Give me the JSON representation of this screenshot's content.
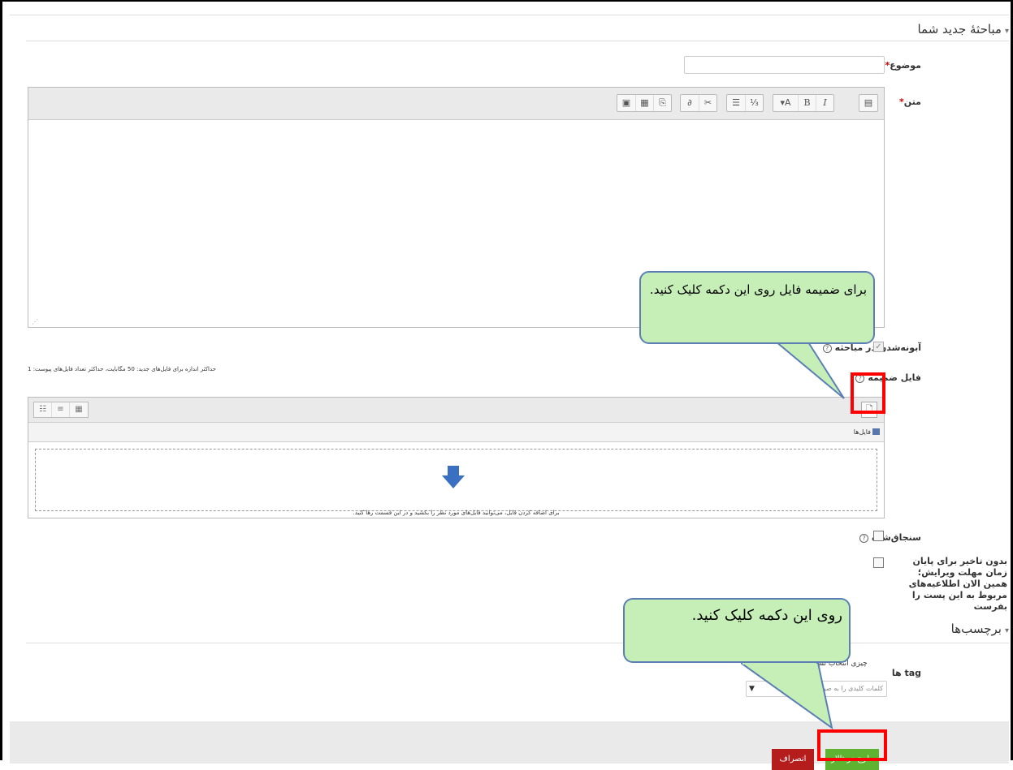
{
  "section_discussion": {
    "title": "مباحثهٔ جدید شما"
  },
  "subject": {
    "label": "موضوع",
    "value": ""
  },
  "message": {
    "label": "متن"
  },
  "editor_toolbar": [
    {
      "name": "toggle-toolbar",
      "glyph": "▤"
    },
    {
      "name": "font-style",
      "glyph": "▾A"
    },
    {
      "name": "bold",
      "glyph": "B"
    },
    {
      "name": "italic",
      "glyph": "I"
    },
    {
      "name": "unordered-list",
      "glyph": "☰"
    },
    {
      "name": "ordered-list",
      "glyph": "⅓"
    },
    {
      "name": "link",
      "glyph": "∂"
    },
    {
      "name": "unlink",
      "glyph": "✂"
    },
    {
      "name": "image",
      "glyph": "▣"
    },
    {
      "name": "media",
      "glyph": "▦"
    },
    {
      "name": "manage-files",
      "glyph": "⎘"
    }
  ],
  "subscribe": {
    "label": "آبونه‌شدن در مباحثه",
    "checked": true
  },
  "attachment": {
    "label": "فایل ضمیمه",
    "limits": "حداکثر اندازه برای فایل‌های جدید: 50 مگابایت، حداکثر تعداد فایل‌های پیوست: 1",
    "path": "فایل‌ها",
    "drop_text": "برای اضافه کردن فایل، می‌توانید فایل‌های مورد نظر را بکشید و در این قسمت رها کنید."
  },
  "pinned": {
    "label": "سنجاق‌شده",
    "checked": false
  },
  "mail_now": {
    "label": "بدون تاخیر برای پایان زمان مهلت ویرایش؛ همین الان اطلاعیه‌های مربوط به این پست را بفرست",
    "checked": false
  },
  "section_tags": {
    "title": "برچسب‌ها"
  },
  "tags": {
    "label": "tag ها",
    "no_selection": "چیزی انتخاب نشده",
    "placeholder": "کلمات کلیدی را به صورت تگ وارد کنید"
  },
  "buttons": {
    "submit": "طرح در تالار",
    "cancel": "انصراف"
  },
  "callouts": {
    "attach": "برای ضمیمه فایل روی این دکمه کلیک کنید.",
    "submit": "روی این دکمه کلیک کنید."
  },
  "colors": {
    "submit": "#5eb331",
    "cancel": "#b51c1c",
    "callout_fill": "#c6efb8",
    "callout_border": "#5b7fb5",
    "highlight": "#ff0000"
  }
}
